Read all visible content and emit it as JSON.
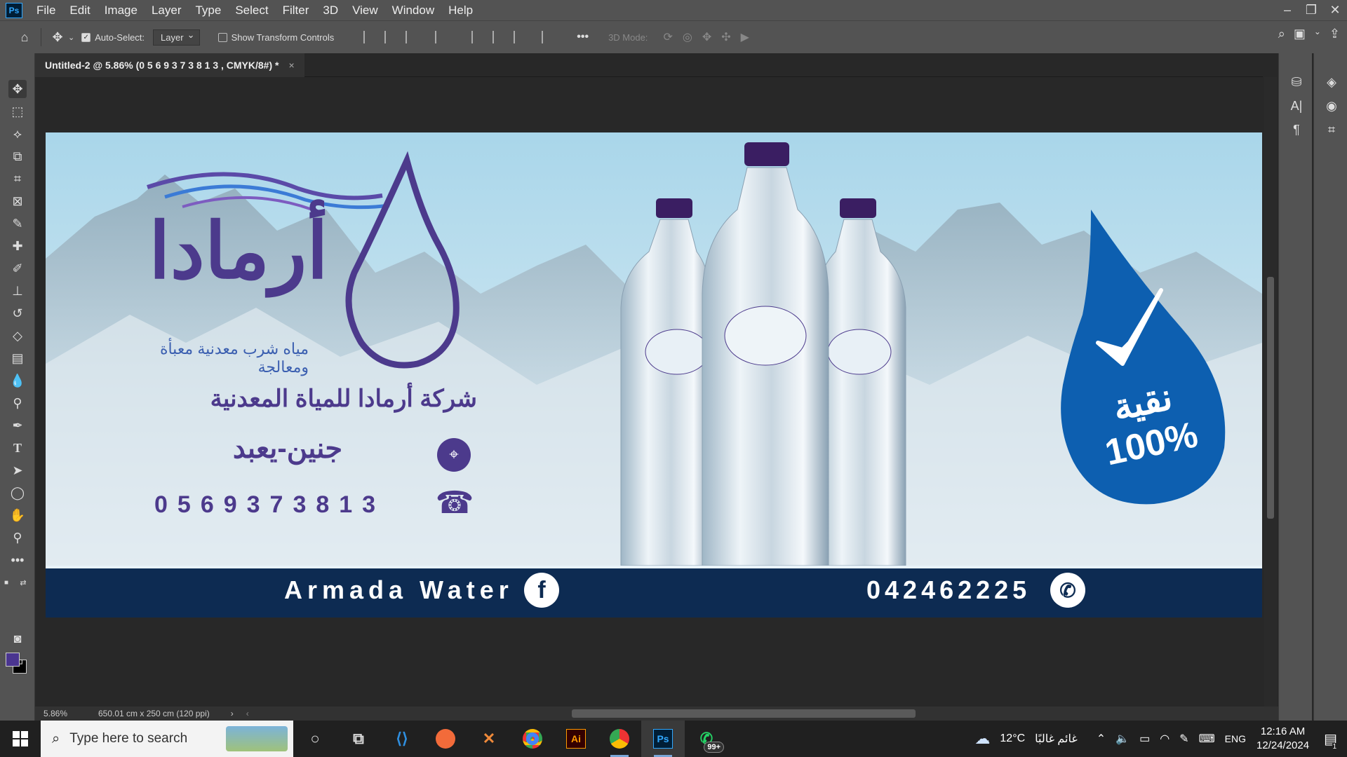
{
  "menubar": {
    "app_icon": "Ps",
    "items": [
      "File",
      "Edit",
      "Image",
      "Layer",
      "Type",
      "Select",
      "Filter",
      "3D",
      "View",
      "Window",
      "Help"
    ],
    "window_controls": [
      "minimize-icon",
      "restore-icon",
      "close-icon"
    ]
  },
  "options_bar": {
    "auto_select_label": "Auto-Select:",
    "auto_select_checked": true,
    "auto_select_target": "Layer",
    "transform_controls_label": "Show Transform Controls",
    "transform_controls_checked": false,
    "more_label": "•••",
    "mode_label": "3D Mode:"
  },
  "document": {
    "tab_title": "Untitled-2 @ 5.86% (0 5 6 9 3 7 3 8 1 3 , CMYK/8#) *",
    "close": "×"
  },
  "status": {
    "zoom": "5.86%",
    "doc_info": "650.01 cm x 250 cm (120 ppi)"
  },
  "design": {
    "logo_text": "أرمادا",
    "tagline": "مياه شرب معدنية معبأة ومعالجة",
    "company_name": "شركة أرمادا للمياة المعدنية",
    "location": "جنين-يعبد",
    "mobile": "0569373813",
    "pure_word": "نقية",
    "pure_percent": "100%",
    "footer_brand": "Armada Water",
    "footer_phone": "042462225",
    "colors": {
      "purple": "#4c3a8c",
      "navy": "#0d2b52",
      "drop_blue": "#0d5fb0",
      "sky": "#a9d6ea"
    }
  },
  "taskbar": {
    "search_placeholder": "Type here to search",
    "apps": [
      "cortana-icon",
      "task-view-icon",
      "vscode-icon",
      "postman-icon",
      "xampp-icon",
      "chrome-icon",
      "illustrator-icon",
      "chrome-profile-icon",
      "photoshop-icon",
      "whatsapp-icon"
    ],
    "whatsapp_badge": "99+",
    "weather_temp": "12°C",
    "weather_desc": "غائم غالبًا",
    "language": "ENG",
    "time": "12:16 AM",
    "date": "12/24/2024",
    "notification_count": "1"
  }
}
